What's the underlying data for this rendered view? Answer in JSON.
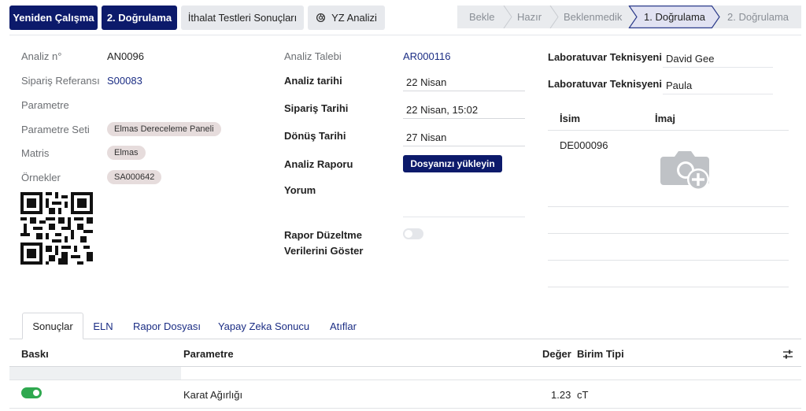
{
  "toolbar": {
    "restart_label": "Yeniden Çalışma",
    "second_validation_label": "2. Doğrulama",
    "import_results_label": "İthalat Testleri Sonuçları",
    "ai_analysis_label": "YZ Analizi"
  },
  "status": {
    "stages": [
      "Bekle",
      "Hazır",
      "Beklenmedik",
      "1. Doğrulama",
      "2. Doğrulama"
    ],
    "active": "1. Doğrulama"
  },
  "form": {
    "analysis_no_label": "Analiz n°",
    "analysis_no": "AN0096",
    "order_ref_label": "Sipariş Referansı",
    "order_ref": "S00083",
    "parameter_label": "Parametre",
    "parameter_set_label": "Parametre Seti",
    "parameter_set": "Elmas Dereceleme Paneli",
    "matrix_label": "Matris",
    "matrix": "Elmas",
    "samples_label": "Örnekler",
    "sample": "SA000642",
    "analysis_request_label": "Analiz Talebi",
    "analysis_request": "AR000116",
    "analysis_date_label": "Analiz tarihi",
    "analysis_date": "22 Nisan",
    "order_date_label": "Sipariş Tarihi",
    "order_date": "22 Nisan, 15:02",
    "return_date_label": "Dönüş Tarihi",
    "return_date": "27 Nisan",
    "report_label": "Analiz Raporu",
    "upload_label": "Dosyanızı yükleyin",
    "comment_label": "Yorum",
    "report_fix_label_1": "Rapor Düzeltme",
    "report_fix_label_2": "Verilerini Göster",
    "report_fix_enabled": false
  },
  "technicians": {
    "label": "Laboratuvar Teknisyeni",
    "names": [
      "David Gee",
      "Paula"
    ]
  },
  "images": {
    "col_name": "İsim",
    "col_image": "İmaj",
    "rows": [
      {
        "name": "DE000096"
      }
    ]
  },
  "tabs": [
    "Sonuçlar",
    "ELN",
    "Rapor Dosyası",
    "Yapay Zeka Sonucu",
    "Atıflar"
  ],
  "active_tab": "Sonuçlar",
  "results": {
    "headers": {
      "print": "Baskı",
      "parameter": "Parametre",
      "value": "Değer",
      "unit": "Birim Tipi"
    },
    "rows": [
      {
        "print": true,
        "parameter": "Karat Ağırlığı",
        "value": "1.23",
        "unit": "cT"
      }
    ]
  },
  "colors": {
    "primary": "#0c1a6b",
    "link": "#1b2d84",
    "toggle_on": "#2fa84f",
    "tag_bg": "#e6dcdc"
  }
}
